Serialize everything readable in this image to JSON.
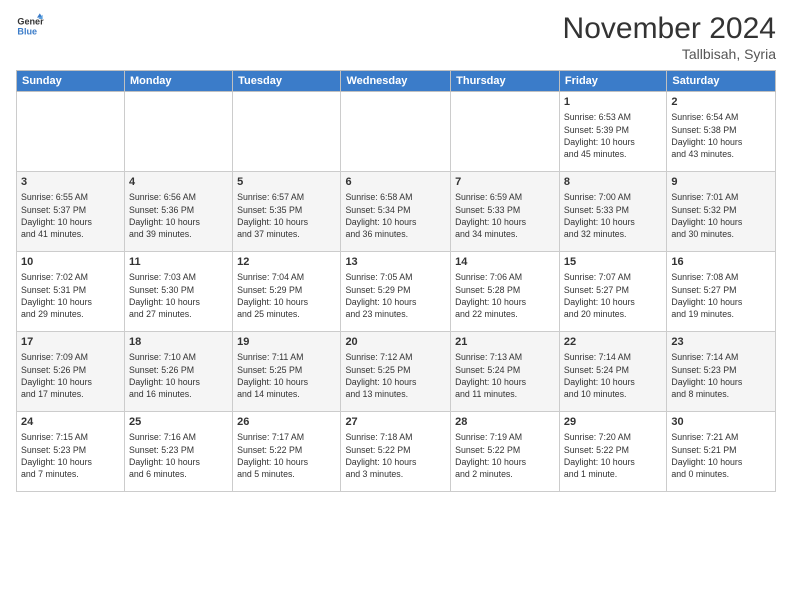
{
  "logo": {
    "line1": "General",
    "line2": "Blue"
  },
  "title": "November 2024",
  "location": "Tallbisah, Syria",
  "headers": [
    "Sunday",
    "Monday",
    "Tuesday",
    "Wednesday",
    "Thursday",
    "Friday",
    "Saturday"
  ],
  "weeks": [
    [
      {
        "day": "",
        "info": ""
      },
      {
        "day": "",
        "info": ""
      },
      {
        "day": "",
        "info": ""
      },
      {
        "day": "",
        "info": ""
      },
      {
        "day": "",
        "info": ""
      },
      {
        "day": "1",
        "info": "Sunrise: 6:53 AM\nSunset: 5:39 PM\nDaylight: 10 hours\nand 45 minutes."
      },
      {
        "day": "2",
        "info": "Sunrise: 6:54 AM\nSunset: 5:38 PM\nDaylight: 10 hours\nand 43 minutes."
      }
    ],
    [
      {
        "day": "3",
        "info": "Sunrise: 6:55 AM\nSunset: 5:37 PM\nDaylight: 10 hours\nand 41 minutes."
      },
      {
        "day": "4",
        "info": "Sunrise: 6:56 AM\nSunset: 5:36 PM\nDaylight: 10 hours\nand 39 minutes."
      },
      {
        "day": "5",
        "info": "Sunrise: 6:57 AM\nSunset: 5:35 PM\nDaylight: 10 hours\nand 37 minutes."
      },
      {
        "day": "6",
        "info": "Sunrise: 6:58 AM\nSunset: 5:34 PM\nDaylight: 10 hours\nand 36 minutes."
      },
      {
        "day": "7",
        "info": "Sunrise: 6:59 AM\nSunset: 5:33 PM\nDaylight: 10 hours\nand 34 minutes."
      },
      {
        "day": "8",
        "info": "Sunrise: 7:00 AM\nSunset: 5:33 PM\nDaylight: 10 hours\nand 32 minutes."
      },
      {
        "day": "9",
        "info": "Sunrise: 7:01 AM\nSunset: 5:32 PM\nDaylight: 10 hours\nand 30 minutes."
      }
    ],
    [
      {
        "day": "10",
        "info": "Sunrise: 7:02 AM\nSunset: 5:31 PM\nDaylight: 10 hours\nand 29 minutes."
      },
      {
        "day": "11",
        "info": "Sunrise: 7:03 AM\nSunset: 5:30 PM\nDaylight: 10 hours\nand 27 minutes."
      },
      {
        "day": "12",
        "info": "Sunrise: 7:04 AM\nSunset: 5:29 PM\nDaylight: 10 hours\nand 25 minutes."
      },
      {
        "day": "13",
        "info": "Sunrise: 7:05 AM\nSunset: 5:29 PM\nDaylight: 10 hours\nand 23 minutes."
      },
      {
        "day": "14",
        "info": "Sunrise: 7:06 AM\nSunset: 5:28 PM\nDaylight: 10 hours\nand 22 minutes."
      },
      {
        "day": "15",
        "info": "Sunrise: 7:07 AM\nSunset: 5:27 PM\nDaylight: 10 hours\nand 20 minutes."
      },
      {
        "day": "16",
        "info": "Sunrise: 7:08 AM\nSunset: 5:27 PM\nDaylight: 10 hours\nand 19 minutes."
      }
    ],
    [
      {
        "day": "17",
        "info": "Sunrise: 7:09 AM\nSunset: 5:26 PM\nDaylight: 10 hours\nand 17 minutes."
      },
      {
        "day": "18",
        "info": "Sunrise: 7:10 AM\nSunset: 5:26 PM\nDaylight: 10 hours\nand 16 minutes."
      },
      {
        "day": "19",
        "info": "Sunrise: 7:11 AM\nSunset: 5:25 PM\nDaylight: 10 hours\nand 14 minutes."
      },
      {
        "day": "20",
        "info": "Sunrise: 7:12 AM\nSunset: 5:25 PM\nDaylight: 10 hours\nand 13 minutes."
      },
      {
        "day": "21",
        "info": "Sunrise: 7:13 AM\nSunset: 5:24 PM\nDaylight: 10 hours\nand 11 minutes."
      },
      {
        "day": "22",
        "info": "Sunrise: 7:14 AM\nSunset: 5:24 PM\nDaylight: 10 hours\nand 10 minutes."
      },
      {
        "day": "23",
        "info": "Sunrise: 7:14 AM\nSunset: 5:23 PM\nDaylight: 10 hours\nand 8 minutes."
      }
    ],
    [
      {
        "day": "24",
        "info": "Sunrise: 7:15 AM\nSunset: 5:23 PM\nDaylight: 10 hours\nand 7 minutes."
      },
      {
        "day": "25",
        "info": "Sunrise: 7:16 AM\nSunset: 5:23 PM\nDaylight: 10 hours\nand 6 minutes."
      },
      {
        "day": "26",
        "info": "Sunrise: 7:17 AM\nSunset: 5:22 PM\nDaylight: 10 hours\nand 5 minutes."
      },
      {
        "day": "27",
        "info": "Sunrise: 7:18 AM\nSunset: 5:22 PM\nDaylight: 10 hours\nand 3 minutes."
      },
      {
        "day": "28",
        "info": "Sunrise: 7:19 AM\nSunset: 5:22 PM\nDaylight: 10 hours\nand 2 minutes."
      },
      {
        "day": "29",
        "info": "Sunrise: 7:20 AM\nSunset: 5:22 PM\nDaylight: 10 hours\nand 1 minute."
      },
      {
        "day": "30",
        "info": "Sunrise: 7:21 AM\nSunset: 5:21 PM\nDaylight: 10 hours\nand 0 minutes."
      }
    ]
  ]
}
